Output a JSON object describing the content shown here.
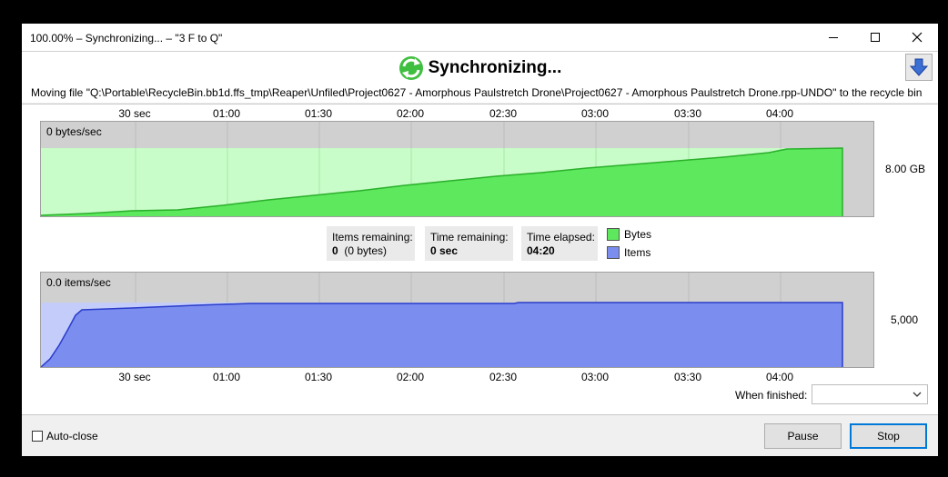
{
  "window": {
    "title": "100.00% – Synchronizing... – \"3 F to Q\""
  },
  "icons": {
    "minimize": "minimize-icon",
    "maximize": "maximize-icon",
    "close": "close-icon",
    "sync": "sync-icon",
    "download": "download-arrow-icon",
    "dropdown": "chevron-down-icon"
  },
  "header": {
    "status_title": "Synchronizing...",
    "status_detail": "Moving file \"Q:\\Portable\\RecycleBin.bb1d.ffs_tmp\\Reaper\\Unfiled\\Project0627 - Amorphous Paulstretch Drone\\Project0627 - Amorphous Paulstretch Drone.rpp-UNDO\" to the recycle bin"
  },
  "graphs": {
    "x_ticks": [
      "30 sec",
      "01:00",
      "01:30",
      "02:00",
      "02:30",
      "03:00",
      "03:30",
      "04:00"
    ],
    "bytes": {
      "rate_label": "0 bytes/sec",
      "y_label": "8.00 GB",
      "fill_color": "#5ee85e",
      "light_color": "#c8fcc8",
      "line_color": "#2ab02a"
    },
    "items": {
      "rate_label": "0.0 items/sec",
      "y_label": "5,000",
      "fill_color": "#7b8ef0",
      "light_color": "#c4cdfa",
      "line_color": "#2a3cc8"
    }
  },
  "stats": {
    "items_remaining_label": "Items remaining:",
    "items_remaining_value": "0",
    "items_remaining_bytes": "(0 bytes)",
    "time_remaining_label": "Time remaining:",
    "time_remaining_value": "0 sec",
    "time_elapsed_label": "Time elapsed:",
    "time_elapsed_value": "04:20"
  },
  "legend": {
    "bytes": "Bytes",
    "items": "Items",
    "bytes_color": "#5ee85e",
    "items_color": "#7b8ef0"
  },
  "when_finished": {
    "label": "When finished:",
    "value": ""
  },
  "footer": {
    "auto_close_label": "Auto-close",
    "auto_close_checked": false,
    "pause_label": "Pause",
    "stop_label": "Stop"
  }
}
